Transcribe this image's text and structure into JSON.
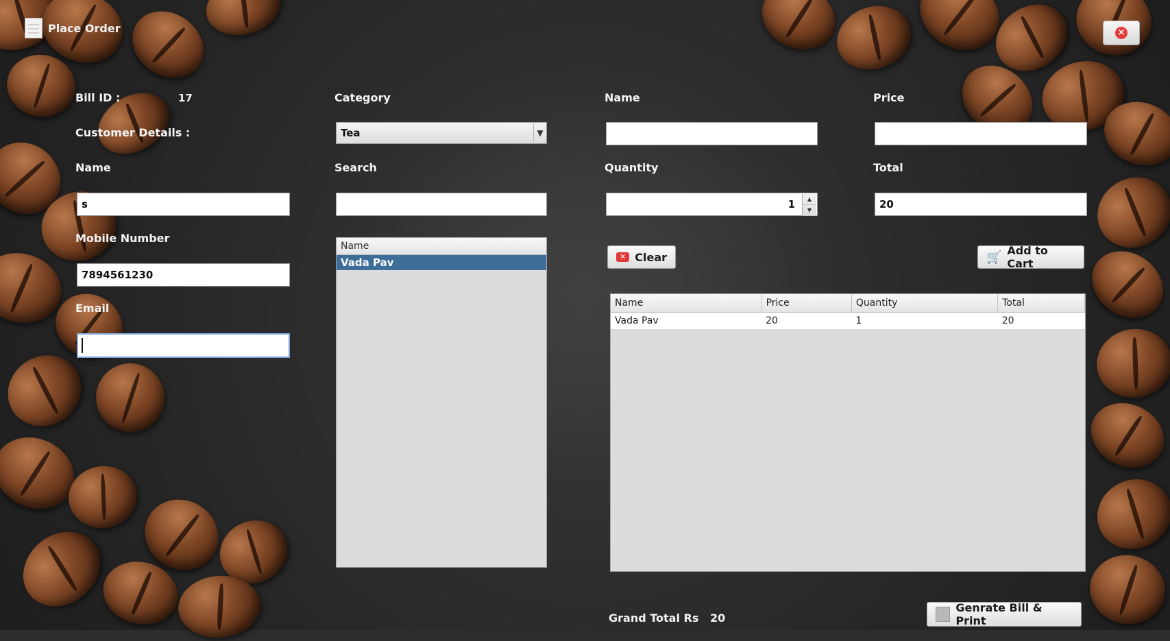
{
  "window": {
    "title": "Place Order"
  },
  "bill": {
    "label": "Bill ID :",
    "value": "17"
  },
  "customer": {
    "section_label": "Customer Details :",
    "name_label": "Name",
    "name_value": "s",
    "mobile_label": "Mobile Number",
    "mobile_value": "7894561230",
    "email_label": "Email",
    "email_value": ""
  },
  "product_filter": {
    "category_label": "Category",
    "category_selected": "Tea",
    "search_label": "Search",
    "search_value": "",
    "list_header": "Name",
    "list_items": [
      "Vada Pav"
    ]
  },
  "item": {
    "name_label": "Name",
    "name_value": "",
    "price_label": "Price",
    "price_value": "",
    "quantity_label": "Quantity",
    "quantity_value": "1",
    "total_label": "Total",
    "total_value": "20"
  },
  "actions": {
    "clear_label": "Clear",
    "add_to_cart_label": "Add to Cart",
    "generate_bill_label": "Genrate Bill & Print"
  },
  "cart": {
    "columns": [
      "Name",
      "Price",
      "Quantity",
      "Total"
    ],
    "rows": [
      [
        "Vada Pav",
        "20",
        "1",
        "20"
      ]
    ]
  },
  "grand_total": {
    "label": "Grand Total Rs",
    "value": "20"
  },
  "colors": {
    "selection": "#3d6d99",
    "close_red": "#e23b3b",
    "label_text": "#f3f3f3"
  },
  "icons": {
    "window": "document-icon",
    "close": "close-icon",
    "clear": "clear-x-icon",
    "add_to_cart": "cart-icon",
    "generate_bill": "printer-icon"
  }
}
